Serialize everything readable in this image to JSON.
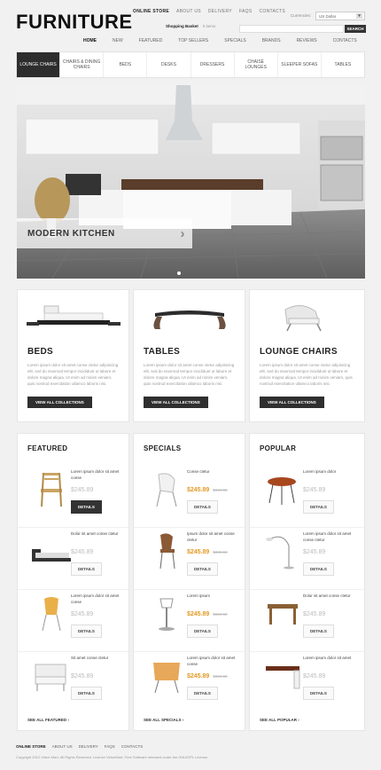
{
  "header": {
    "logo": "FURNITURE",
    "top_links": [
      "ONLINE STORE",
      "ABOUT US",
      "DELIVERY",
      "FAQS",
      "CONTACTS"
    ],
    "currencies_label": "Currencies:",
    "currency_value": "US Dollar",
    "basket_label": "Shopping Basket",
    "basket_count": "0 items",
    "search_button": "SEARCH"
  },
  "main_nav": [
    "HOME",
    "NEW",
    "FEATURED",
    "TOP SELLERS",
    "SPECIALS",
    "BRANDS",
    "REVIEWS",
    "CONTACTS"
  ],
  "categories": [
    {
      "label": "LOUNGE CHAIRS",
      "active": true
    },
    {
      "label": "CHAIRS & DINING CHAIRS",
      "active": false
    },
    {
      "label": "BEDS",
      "active": false
    },
    {
      "label": "DESKS",
      "active": false
    },
    {
      "label": "DRESSERS",
      "active": false
    },
    {
      "label": "CHAISE LOUNGES",
      "active": false
    },
    {
      "label": "SLEEPER SOFAS",
      "active": false
    },
    {
      "label": "TABLES",
      "active": false
    }
  ],
  "hero": {
    "caption": "MODERN KITCHEN",
    "arrow": "›"
  },
  "collections": [
    {
      "title": "BEDS",
      "text": "Lorem ipsum dolor sit amet conse ctetur adipisicing elit, sed do eiusmod tempor incididunt ut labore et dolore magna aliqua. Ut enim ad minim veniam, quis nostrud exercitation ullamco laboris nisi.",
      "button": "VIEW ALL COLLECTIONS"
    },
    {
      "title": "TABLES",
      "text": "Lorem ipsum dolor sit amet conse ctetur adipisicing elit, sed do eiusmod tempor incididunt ut labore et dolore magna aliqua. Ut enim ad minim veniam, quis nostrud exercitation ullamco laboris nisi.",
      "button": "VIEW ALL COLLECTIONS"
    },
    {
      "title": "LOUNGE CHAIRS",
      "text": "Lorem ipsum dolor sit amet conse ctetur adipisicing elit, sed do eiusmod tempor incididunt ut labore et dolore magna aliqua. Ut enim ad minim veniam, quis nostrud exercitation ullamco laboris nisi.",
      "button": "VIEW ALL COLLECTIONS"
    }
  ],
  "featured": {
    "title": "FEATURED",
    "see_all": "SEE ALL FEATURED",
    "items": [
      {
        "name": "Lorem ipsum dolor sit amet conse",
        "price": "$245.89",
        "button": "DETAILS"
      },
      {
        "name": "Dolor sit amet conse ctetur",
        "price": "$245.89",
        "button": "DETAILS"
      },
      {
        "name": "Lorem ipsum dolor sit amet conse",
        "price": "$245.89",
        "button": "DETAILS"
      },
      {
        "name": "Sit amet conse ctetur",
        "price": "$245.89",
        "button": "DETAILS"
      }
    ]
  },
  "specials": {
    "title": "SPECIALS",
    "see_all": "SEE ALL SPECIALS",
    "items": [
      {
        "name": "Conse ctetur",
        "price": "$245.89",
        "old": "$369.58",
        "button": "DETAILS"
      },
      {
        "name": "Ipsum dolor sit amet conse ctetur",
        "price": "$245.89",
        "old": "$369.58",
        "button": "DETAILS"
      },
      {
        "name": "Lorem ipsum",
        "price": "$245.89",
        "old": "$369.58",
        "button": "DETAILS"
      },
      {
        "name": "Lorem ipsum dolor sit amet conse",
        "price": "$245.89",
        "old": "$369.58",
        "button": "DETAILS"
      }
    ]
  },
  "popular": {
    "title": "POPULAR",
    "see_all": "SEE ALL POPULAR",
    "items": [
      {
        "name": "Lorem ipsum dolor",
        "price": "$245.89",
        "button": "DETAILS"
      },
      {
        "name": "Lorem ipsum dolor sit amet conse ctetur",
        "price": "$245.89",
        "button": "DETAILS"
      },
      {
        "name": "Dolor sit amet conse ctetur",
        "price": "$245.89",
        "button": "DETAILS"
      },
      {
        "name": "Lorem ipsum dolor sit amet",
        "price": "$245.89",
        "button": "DETAILS"
      }
    ]
  },
  "footer": {
    "links": [
      "ONLINE STORE",
      "ABOUT US",
      "DELIVERY",
      "FAQS",
      "CONTACTS"
    ],
    "copyright": "Copyright 2012 Virtue Mart. All Rights Reserved. License VirtueMart: Free Software released under the GNU/GPL License."
  },
  "colors": {
    "accent": "#e49a25",
    "dark": "#2d2d2d"
  }
}
